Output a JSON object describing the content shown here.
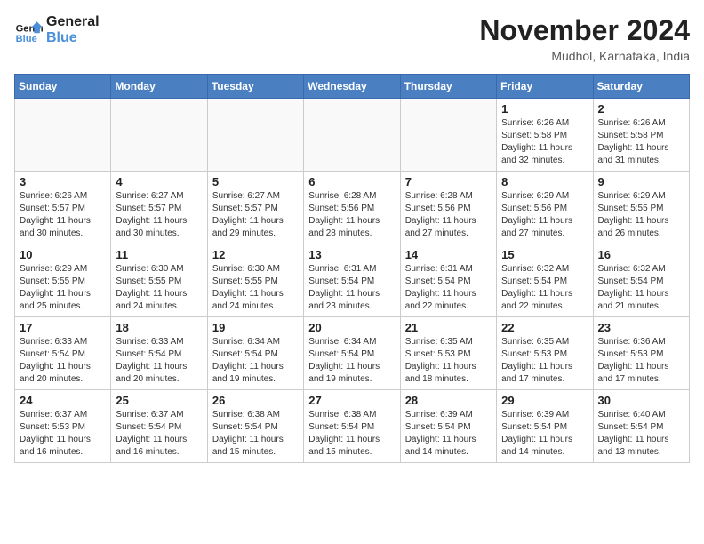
{
  "header": {
    "logo_line1": "General",
    "logo_line2": "Blue",
    "month": "November 2024",
    "location": "Mudhol, Karnataka, India"
  },
  "weekdays": [
    "Sunday",
    "Monday",
    "Tuesday",
    "Wednesday",
    "Thursday",
    "Friday",
    "Saturday"
  ],
  "weeks": [
    [
      {
        "day": "",
        "text": ""
      },
      {
        "day": "",
        "text": ""
      },
      {
        "day": "",
        "text": ""
      },
      {
        "day": "",
        "text": ""
      },
      {
        "day": "",
        "text": ""
      },
      {
        "day": "1",
        "text": "Sunrise: 6:26 AM\nSunset: 5:58 PM\nDaylight: 11 hours\nand 32 minutes."
      },
      {
        "day": "2",
        "text": "Sunrise: 6:26 AM\nSunset: 5:58 PM\nDaylight: 11 hours\nand 31 minutes."
      }
    ],
    [
      {
        "day": "3",
        "text": "Sunrise: 6:26 AM\nSunset: 5:57 PM\nDaylight: 11 hours\nand 30 minutes."
      },
      {
        "day": "4",
        "text": "Sunrise: 6:27 AM\nSunset: 5:57 PM\nDaylight: 11 hours\nand 30 minutes."
      },
      {
        "day": "5",
        "text": "Sunrise: 6:27 AM\nSunset: 5:57 PM\nDaylight: 11 hours\nand 29 minutes."
      },
      {
        "day": "6",
        "text": "Sunrise: 6:28 AM\nSunset: 5:56 PM\nDaylight: 11 hours\nand 28 minutes."
      },
      {
        "day": "7",
        "text": "Sunrise: 6:28 AM\nSunset: 5:56 PM\nDaylight: 11 hours\nand 27 minutes."
      },
      {
        "day": "8",
        "text": "Sunrise: 6:29 AM\nSunset: 5:56 PM\nDaylight: 11 hours\nand 27 minutes."
      },
      {
        "day": "9",
        "text": "Sunrise: 6:29 AM\nSunset: 5:55 PM\nDaylight: 11 hours\nand 26 minutes."
      }
    ],
    [
      {
        "day": "10",
        "text": "Sunrise: 6:29 AM\nSunset: 5:55 PM\nDaylight: 11 hours\nand 25 minutes."
      },
      {
        "day": "11",
        "text": "Sunrise: 6:30 AM\nSunset: 5:55 PM\nDaylight: 11 hours\nand 24 minutes."
      },
      {
        "day": "12",
        "text": "Sunrise: 6:30 AM\nSunset: 5:55 PM\nDaylight: 11 hours\nand 24 minutes."
      },
      {
        "day": "13",
        "text": "Sunrise: 6:31 AM\nSunset: 5:54 PM\nDaylight: 11 hours\nand 23 minutes."
      },
      {
        "day": "14",
        "text": "Sunrise: 6:31 AM\nSunset: 5:54 PM\nDaylight: 11 hours\nand 22 minutes."
      },
      {
        "day": "15",
        "text": "Sunrise: 6:32 AM\nSunset: 5:54 PM\nDaylight: 11 hours\nand 22 minutes."
      },
      {
        "day": "16",
        "text": "Sunrise: 6:32 AM\nSunset: 5:54 PM\nDaylight: 11 hours\nand 21 minutes."
      }
    ],
    [
      {
        "day": "17",
        "text": "Sunrise: 6:33 AM\nSunset: 5:54 PM\nDaylight: 11 hours\nand 20 minutes."
      },
      {
        "day": "18",
        "text": "Sunrise: 6:33 AM\nSunset: 5:54 PM\nDaylight: 11 hours\nand 20 minutes."
      },
      {
        "day": "19",
        "text": "Sunrise: 6:34 AM\nSunset: 5:54 PM\nDaylight: 11 hours\nand 19 minutes."
      },
      {
        "day": "20",
        "text": "Sunrise: 6:34 AM\nSunset: 5:54 PM\nDaylight: 11 hours\nand 19 minutes."
      },
      {
        "day": "21",
        "text": "Sunrise: 6:35 AM\nSunset: 5:53 PM\nDaylight: 11 hours\nand 18 minutes."
      },
      {
        "day": "22",
        "text": "Sunrise: 6:35 AM\nSunset: 5:53 PM\nDaylight: 11 hours\nand 17 minutes."
      },
      {
        "day": "23",
        "text": "Sunrise: 6:36 AM\nSunset: 5:53 PM\nDaylight: 11 hours\nand 17 minutes."
      }
    ],
    [
      {
        "day": "24",
        "text": "Sunrise: 6:37 AM\nSunset: 5:53 PM\nDaylight: 11 hours\nand 16 minutes."
      },
      {
        "day": "25",
        "text": "Sunrise: 6:37 AM\nSunset: 5:54 PM\nDaylight: 11 hours\nand 16 minutes."
      },
      {
        "day": "26",
        "text": "Sunrise: 6:38 AM\nSunset: 5:54 PM\nDaylight: 11 hours\nand 15 minutes."
      },
      {
        "day": "27",
        "text": "Sunrise: 6:38 AM\nSunset: 5:54 PM\nDaylight: 11 hours\nand 15 minutes."
      },
      {
        "day": "28",
        "text": "Sunrise: 6:39 AM\nSunset: 5:54 PM\nDaylight: 11 hours\nand 14 minutes."
      },
      {
        "day": "29",
        "text": "Sunrise: 6:39 AM\nSunset: 5:54 PM\nDaylight: 11 hours\nand 14 minutes."
      },
      {
        "day": "30",
        "text": "Sunrise: 6:40 AM\nSunset: 5:54 PM\nDaylight: 11 hours\nand 13 minutes."
      }
    ]
  ]
}
